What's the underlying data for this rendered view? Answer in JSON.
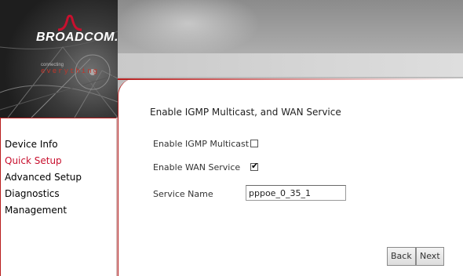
{
  "brand": {
    "logo_text": "BROADCOM.",
    "tagline_small": "connecting",
    "tagline": "everything"
  },
  "colors": {
    "accent": "#c8102e",
    "border": "#b81e1e"
  },
  "menu": {
    "items": [
      {
        "label": "Device Info",
        "active": false
      },
      {
        "label": "Quick Setup",
        "active": true
      },
      {
        "label": "Advanced Setup",
        "active": false
      },
      {
        "label": "Diagnostics",
        "active": false
      },
      {
        "label": "Management",
        "active": false
      }
    ]
  },
  "main": {
    "title": "Enable IGMP Multicast, and WAN Service",
    "igmp": {
      "label": "Enable IGMP Multicast",
      "checked": false
    },
    "wan": {
      "label": "Enable WAN Service",
      "checked": true
    },
    "service_name": {
      "label": "Service Name",
      "value": "pppoe_0_35_1"
    },
    "buttons": {
      "back": "Back",
      "next": "Next"
    }
  }
}
